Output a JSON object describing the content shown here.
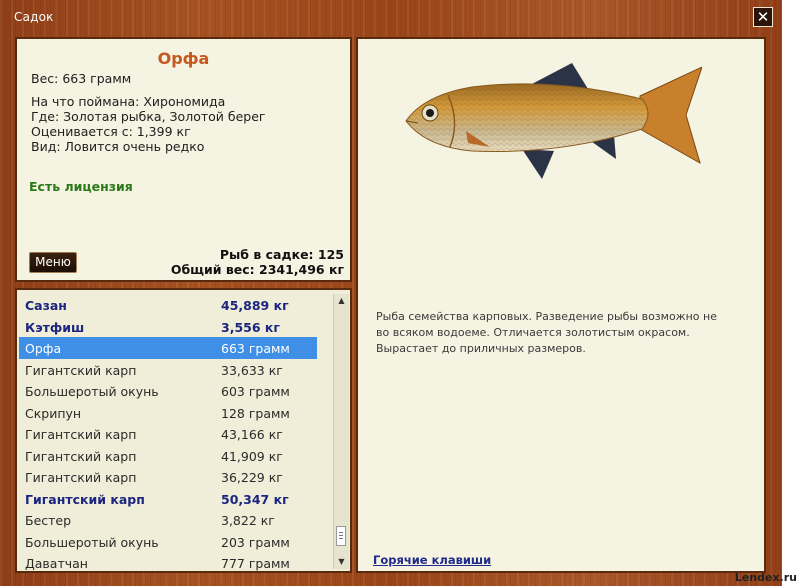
{
  "window": {
    "title": "Садок",
    "close_glyph": "✕"
  },
  "info": {
    "name": "Орфа",
    "weight": "Вес: 663 грамм",
    "caught_with": "На что поймана: Хирономида",
    "location": "Где: Золотая рыбка, Золотой берег",
    "valued_from": "Оценивается с: 1,399 кг",
    "rarity": "Вид: Ловится очень редко",
    "license": "Есть лицензия",
    "menu_button": "Меню",
    "fish_count": "Рыб в садке: 125",
    "total_weight": "Общий вес: 2341,496 кг"
  },
  "list": {
    "items": [
      {
        "name": "Сазан",
        "weight": "45,889 кг",
        "bold": true
      },
      {
        "name": "Кэтфиш",
        "weight": "3,556 кг",
        "bold": true
      },
      {
        "name": "Орфа",
        "weight": "663 грамм",
        "selected": true
      },
      {
        "name": "Гигантский карп",
        "weight": "33,633 кг"
      },
      {
        "name": "Большеротый окунь",
        "weight": "603 грамм"
      },
      {
        "name": "Скрипун",
        "weight": "128 грамм"
      },
      {
        "name": "Гигантский карп",
        "weight": "43,166 кг"
      },
      {
        "name": "Гигантский карп",
        "weight": "41,909 кг"
      },
      {
        "name": "Гигантский карп",
        "weight": "36,229 кг"
      },
      {
        "name": "Гигантский карп",
        "weight": "50,347 кг",
        "bold": true
      },
      {
        "name": "Бестер",
        "weight": "3,822 кг"
      },
      {
        "name": "Большеротый окунь",
        "weight": "203 грамм"
      },
      {
        "name": "Даватчан",
        "weight": "777 грамм"
      }
    ],
    "scroll_up_glyph": "▲",
    "scroll_down_glyph": "▼"
  },
  "detail": {
    "description_lines": [
      "Рыба семейства карповых. Разведение рыбы возможно не",
      "во всяком водоеме. Отличается золотистым окрасом.",
      "Вырастает до приличных размеров."
    ],
    "hotkeys_link": "Горячие клавиши"
  },
  "watermark": "Lendex.ru",
  "colors": {
    "panel_bg": "#f5f3e2",
    "fish_name": "#c5581c",
    "license": "#2b7a16",
    "selected_row": "#3f8fe6",
    "bold_row": "#1c2580",
    "link": "#1f2a8a"
  }
}
